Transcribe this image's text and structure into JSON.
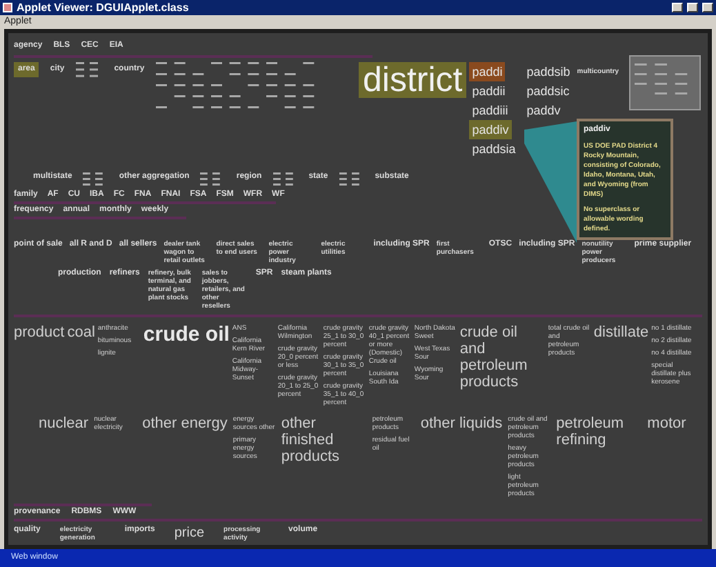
{
  "window": {
    "title": "Applet Viewer: DGUIApplet.class",
    "menu": [
      "Applet"
    ]
  },
  "agency": {
    "items": [
      {
        "text": "agency",
        "kind": "facet"
      },
      {
        "text": "BLS",
        "kind": "facet"
      },
      {
        "text": "CEC",
        "kind": "facet"
      },
      {
        "text": "EIA",
        "kind": "facet"
      }
    ]
  },
  "geography": {
    "left": [
      {
        "text": "area",
        "kind": "facet",
        "selected": true
      },
      {
        "text": "city",
        "kind": "facet",
        "selected": false
      },
      {
        "text": "country",
        "kind": "facet",
        "selected": false
      }
    ],
    "district": {
      "text": "district",
      "selected": true
    },
    "padd": [
      {
        "text": "paddi",
        "selected": false,
        "hovered": true
      },
      {
        "text": "paddii",
        "selected": false,
        "hovered": false
      },
      {
        "text": "paddiii",
        "selected": false,
        "hovered": false
      },
      {
        "text": "paddiv",
        "selected": true,
        "hovered": false
      },
      {
        "text": "paddsia",
        "selected": false,
        "hovered": false
      },
      {
        "text": "paddsib",
        "selected": false,
        "hovered": false
      },
      {
        "text": "paddsic",
        "selected": false,
        "hovered": false
      },
      {
        "text": "paddv",
        "selected": false,
        "hovered": false
      }
    ],
    "multicountry": "multicountry",
    "lower": [
      {
        "text": "multistate",
        "kind": "facet"
      },
      {
        "text": "other aggregation",
        "kind": "facet"
      },
      {
        "text": "region",
        "kind": "facet"
      },
      {
        "text": "state",
        "kind": "facet"
      },
      {
        "text": "substate",
        "kind": "facet"
      }
    ],
    "tooltip": {
      "title": "paddiv",
      "lines": [
        "US DOE PAD District 4 Rocky Mountain, consisting of Colorado, Idaho, Montana, Utah, and Wyoming (from DIMS)",
        "No superclass or allowable wording defined."
      ]
    }
  },
  "family": {
    "items": [
      {
        "text": "family",
        "kind": "facet"
      },
      {
        "text": "AF",
        "kind": "facet"
      },
      {
        "text": "CU",
        "kind": "facet"
      },
      {
        "text": "IBA",
        "kind": "facet"
      },
      {
        "text": "FC",
        "kind": "facet"
      },
      {
        "text": "FNA",
        "kind": "facet"
      },
      {
        "text": "FNAI",
        "kind": "facet"
      },
      {
        "text": "FSA",
        "kind": "facet"
      },
      {
        "text": "FSM",
        "kind": "facet"
      },
      {
        "text": "WFR",
        "kind": "facet"
      },
      {
        "text": "WF",
        "kind": "facet"
      }
    ]
  },
  "frequency": {
    "items": [
      {
        "text": "frequency",
        "kind": "facet"
      },
      {
        "text": "annual",
        "kind": "facet"
      },
      {
        "text": "monthly",
        "kind": "facet"
      },
      {
        "text": "weekly",
        "kind": "facet"
      }
    ]
  },
  "point_of_sale": [
    {
      "items": [
        {
          "text": "point of sale",
          "kind": "facet"
        },
        {
          "text": "all R and D",
          "kind": "facet"
        },
        {
          "text": "all sellers",
          "kind": "facet"
        },
        {
          "text": "dealer tank wagon to retail outlets",
          "kind": "wrap"
        },
        {
          "text": "direct sales to end users",
          "kind": "wrap"
        },
        {
          "text": "electric power industry",
          "kind": "wrap"
        },
        {
          "text": "electric utilities",
          "kind": "wrap"
        },
        {
          "text": "including SPR",
          "kind": "facet"
        },
        {
          "text": "first purchasers",
          "kind": "wrap"
        },
        {
          "text": "OTSC",
          "kind": "facet"
        },
        {
          "text": "including SPR",
          "kind": "facet"
        },
        {
          "text": "nonutility power producers",
          "kind": "wrap"
        },
        {
          "text": "prime supplier",
          "kind": "facet"
        }
      ]
    },
    {
      "items": [
        {
          "text": "production",
          "kind": "facet"
        },
        {
          "text": "refiners",
          "kind": "facet"
        },
        {
          "text": "refinery, bulk terminal, and natural gas plant stocks",
          "kind": "wrap"
        },
        {
          "text": "sales to jobbers, retailers, and other resellers",
          "kind": "wrap"
        },
        {
          "text": "SPR",
          "kind": "facet"
        },
        {
          "text": "steam plants",
          "kind": "facet"
        }
      ]
    }
  ],
  "product": [
    [
      {
        "text": "product",
        "kind": "large"
      }
    ],
    [
      {
        "text": "coal",
        "kind": "large"
      }
    ],
    [
      {
        "text": "anthracite",
        "kind": "value"
      },
      {
        "text": "bituminous",
        "kind": "value"
      },
      {
        "text": "lignite",
        "kind": "value"
      }
    ],
    [
      {
        "text": "crude oil",
        "kind": "bold"
      }
    ],
    [
      {
        "text": "ANS",
        "kind": "value"
      },
      {
        "text": "California Kern River",
        "kind": "value"
      },
      {
        "text": "California Midway-Sunset",
        "kind": "value"
      }
    ],
    [
      {
        "text": "California Wilmington",
        "kind": "value"
      },
      {
        "text": "crude gravity 20_0 percent or less",
        "kind": "value"
      },
      {
        "text": "crude gravity 20_1 to 25_0 percent",
        "kind": "value"
      }
    ],
    [
      {
        "text": "crude gravity 25_1 to 30_0 percent",
        "kind": "value"
      },
      {
        "text": "crude gravity 30_1 to 35_0 percent",
        "kind": "value"
      },
      {
        "text": "crude gravity 35_1 to 40_0 percent",
        "kind": "value"
      }
    ],
    [
      {
        "text": "crude gravity 40_1 percent or more (Domestic) Crude oil",
        "kind": "value"
      },
      {
        "text": "Louisiana South Ida",
        "kind": "value"
      }
    ],
    [
      {
        "text": "North Dakota Sweet",
        "kind": "value"
      },
      {
        "text": "West Texas Sour",
        "kind": "value"
      },
      {
        "text": "Wyoming Sour",
        "kind": "value"
      }
    ],
    [
      {
        "text": "crude oil and petroleum products",
        "kind": "large"
      }
    ],
    [
      {
        "text": "total crude oil and petroleum products",
        "kind": "value"
      }
    ],
    [
      {
        "text": "distillate",
        "kind": "large"
      }
    ],
    [
      {
        "text": "no 1 distillate",
        "kind": "value"
      },
      {
        "text": "no 2 distillate",
        "kind": "value"
      },
      {
        "text": "no 4 distillate",
        "kind": "value"
      },
      {
        "text": "special distillate plus kerosene",
        "kind": "value"
      }
    ]
  ],
  "energy": [
    [
      {
        "text": "nuclear",
        "kind": "large"
      }
    ],
    [
      {
        "text": "nuclear electricity",
        "kind": "value"
      }
    ],
    [
      {
        "text": "other energy",
        "kind": "large"
      }
    ],
    [
      {
        "text": "energy sources other",
        "kind": "value"
      },
      {
        "text": "primary energy sources",
        "kind": "value"
      }
    ],
    [
      {
        "text": "other finished products",
        "kind": "large"
      }
    ],
    [
      {
        "text": "petroleum products",
        "kind": "value"
      },
      {
        "text": "residual fuel oil",
        "kind": "value"
      }
    ],
    [
      {
        "text": "other liquids",
        "kind": "large"
      }
    ],
    [
      {
        "text": "crude oil and petroleum products",
        "kind": "value"
      },
      {
        "text": "heavy petroleum products",
        "kind": "value"
      },
      {
        "text": "light petroleum products",
        "kind": "value"
      }
    ],
    [
      {
        "text": "petroleum refining",
        "kind": "large"
      }
    ],
    [
      {
        "text": "motor",
        "kind": "large"
      }
    ]
  ],
  "provenance": {
    "items": [
      {
        "text": "provenance",
        "kind": "facet"
      },
      {
        "text": "RDBMS",
        "kind": "facet"
      },
      {
        "text": "WWW",
        "kind": "facet"
      }
    ]
  },
  "quality": {
    "items": [
      {
        "text": "quality",
        "kind": "facet"
      },
      {
        "text": "electricity generation",
        "kind": "wrap"
      },
      {
        "text": "imports",
        "kind": "facet"
      },
      {
        "text": "price",
        "kind": "medium"
      },
      {
        "text": "processing activity",
        "kind": "wrap"
      },
      {
        "text": "volume",
        "kind": "facet"
      }
    ]
  },
  "status_bar": "Web window"
}
